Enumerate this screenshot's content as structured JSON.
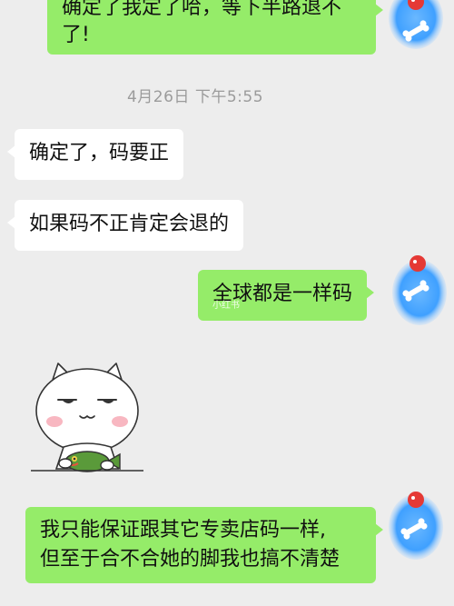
{
  "conversation": {
    "messages": [
      {
        "id": "m1",
        "direction": "out",
        "text_line1": "确定了我定了哈，等下半路退不",
        "text_line2": "了!"
      },
      {
        "id": "m2",
        "direction": "in",
        "text": "确定了，码要正"
      },
      {
        "id": "m3",
        "direction": "in",
        "text": "如果码不正肯定会退的"
      },
      {
        "id": "m4",
        "direction": "out",
        "text": "全球都是一样码"
      },
      {
        "id": "m5",
        "direction": "in",
        "type": "sticker",
        "sticker_name": "smug-cat-sticker"
      },
      {
        "id": "m6",
        "direction": "out",
        "text_line1": "我只能保证跟其它专卖店码一样,",
        "text_line2": "但至于合不合她的脚我也搞不清楚"
      }
    ],
    "timestamp": "4月26日 下午5:55"
  },
  "watermark": "小红书",
  "colors": {
    "background": "#ededed",
    "outgoing_bubble": "#95ec69",
    "incoming_bubble": "#ffffff",
    "timestamp_text": "#9b9b9b",
    "avatar_blur": "#3fa0ff"
  },
  "icons": {
    "avatar_icon": "bone-and-apple-avatar-icon"
  }
}
